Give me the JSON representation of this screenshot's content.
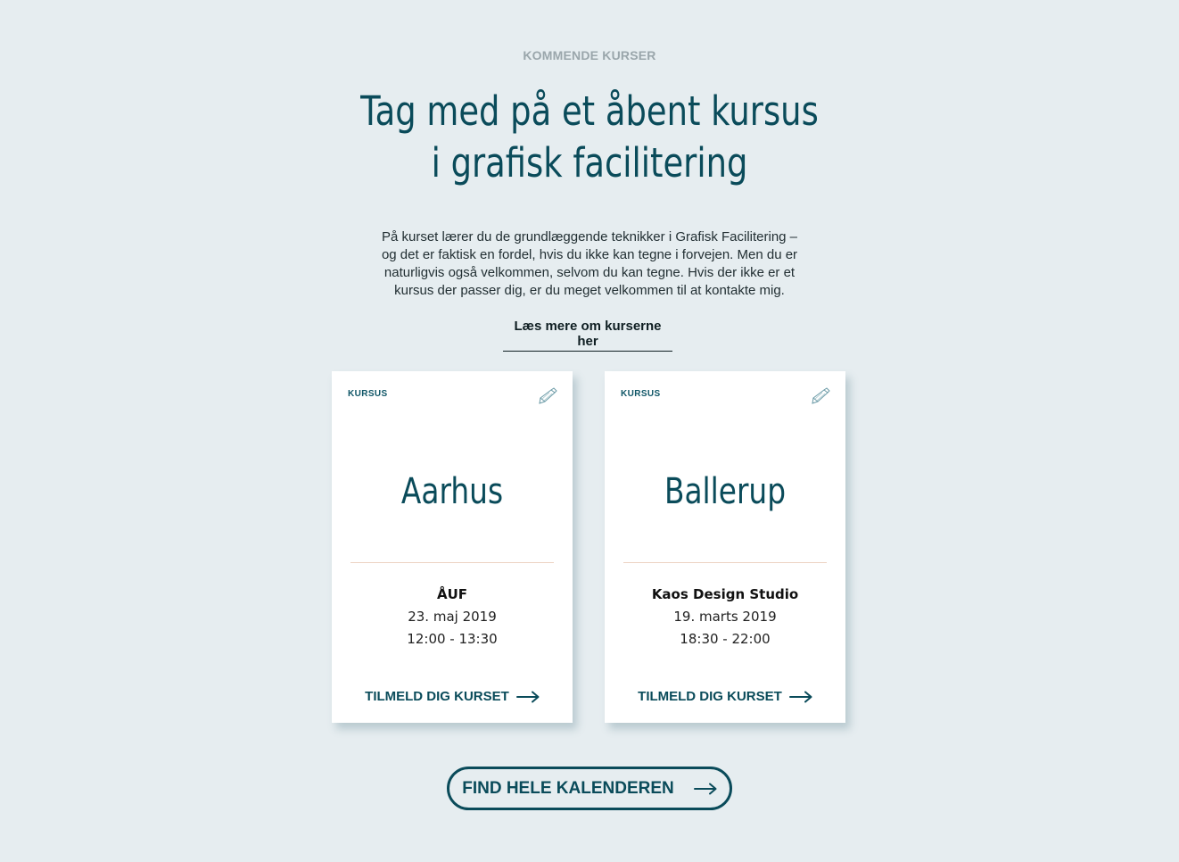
{
  "section": {
    "eyebrow": "KOMMENDE KURSER",
    "headline_line1": "Tag med på et åbent kursus",
    "headline_line2": "i grafisk facilitering",
    "intro": "På kurset lærer du de grundlæggende teknikker i Grafisk Facilitering – og det er faktisk en fordel, hvis du ikke kan tegne i forvejen. Men du er naturligvis også velkommen, selvom du kan tegne. Hvis der ikke er et kursus der passer dig, er du meget velkommen til at kontakte mig.",
    "read_more": "Læs mere om kurserne her"
  },
  "cards": [
    {
      "tag": "KURSUS",
      "icon": "pen-icon",
      "city": "Aarhus",
      "venue": "ÅUF",
      "date": "23. maj 2019",
      "time": "12:00 - 13:30",
      "signup": "TILMELD DIG KURSET"
    },
    {
      "tag": "KURSUS",
      "icon": "pen-icon",
      "city": "Ballerup",
      "venue": "Kaos Design Studio",
      "date": "19. marts 2019",
      "time": "18:30 - 22:00",
      "signup": "TILMELD DIG KURSET"
    }
  ],
  "cta": {
    "label": "FIND HELE KALENDEREN"
  },
  "colors": {
    "background": "#e6edf0",
    "accent": "#0a4b5a",
    "eyebrow": "#9aa6ab",
    "divider": "#ecd3c3"
  }
}
